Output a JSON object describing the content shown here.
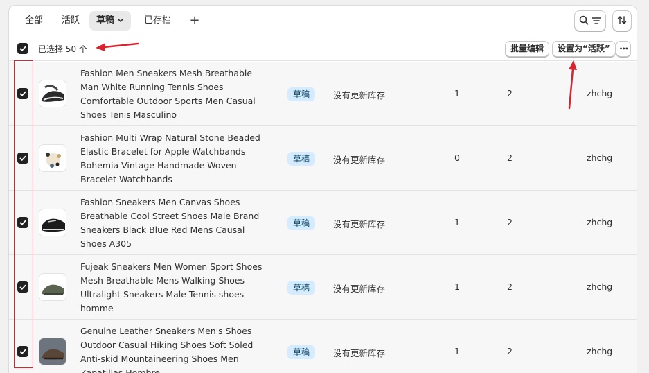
{
  "tabs": [
    {
      "label": "全部"
    },
    {
      "label": "活跃"
    },
    {
      "label": "草稿",
      "active": true
    },
    {
      "label": "已存档"
    }
  ],
  "add_tab_label": "+",
  "bulk": {
    "selected_text": "已选择 50 个",
    "bulk_edit_label": "批量编辑",
    "set_active_label": "设置为“活跃”",
    "more_label": "•••"
  },
  "rows": [
    {
      "title": "Fashion Men Sneakers Mesh Breathable Man White Running Tennis Shoes Comfortable Outdoor Sports Men Casual Shoes Tenis Masculino",
      "status": "草稿",
      "inventory": "没有更新库存",
      "n1": "1",
      "n2": "2",
      "vendor": "zhchg"
    },
    {
      "title": "Fashion Multi Wrap Natural Stone Beaded Elastic Bracelet for Apple Watchbands Bohemia Vintage Handmade Woven Bracelet Watchbands",
      "status": "草稿",
      "inventory": "没有更新库存",
      "n1": "0",
      "n2": "2",
      "vendor": "zhchg"
    },
    {
      "title": "Fashion Sneakers Men Canvas Shoes Breathable Cool Street Shoes Male Brand Sneakers Black Blue Red Mens Causal Shoes A305",
      "status": "草稿",
      "inventory": "没有更新库存",
      "n1": "1",
      "n2": "2",
      "vendor": "zhchg"
    },
    {
      "title": "Fujeak Sneakers Men Women Sport Shoes Mesh Breathable Mens Walking Shoes Ultralight Sneakers Male Tennis shoes homme",
      "status": "草稿",
      "inventory": "没有更新库存",
      "n1": "1",
      "n2": "2",
      "vendor": "zhchg"
    },
    {
      "title": "Genuine Leather Sneakers Men's Shoes Outdoor Casual Hiking Shoes Soft Soled Anti-skid Mountaineering Shoes Men Zapatillas Hombre",
      "status": "草稿",
      "inventory": "没有更新库存",
      "n1": "1",
      "n2": "2",
      "vendor": "zhchg"
    }
  ],
  "colors": {
    "badge_bg": "#d5ebff",
    "annotation_red": "#d9232e",
    "checkbox": "#222222"
  }
}
